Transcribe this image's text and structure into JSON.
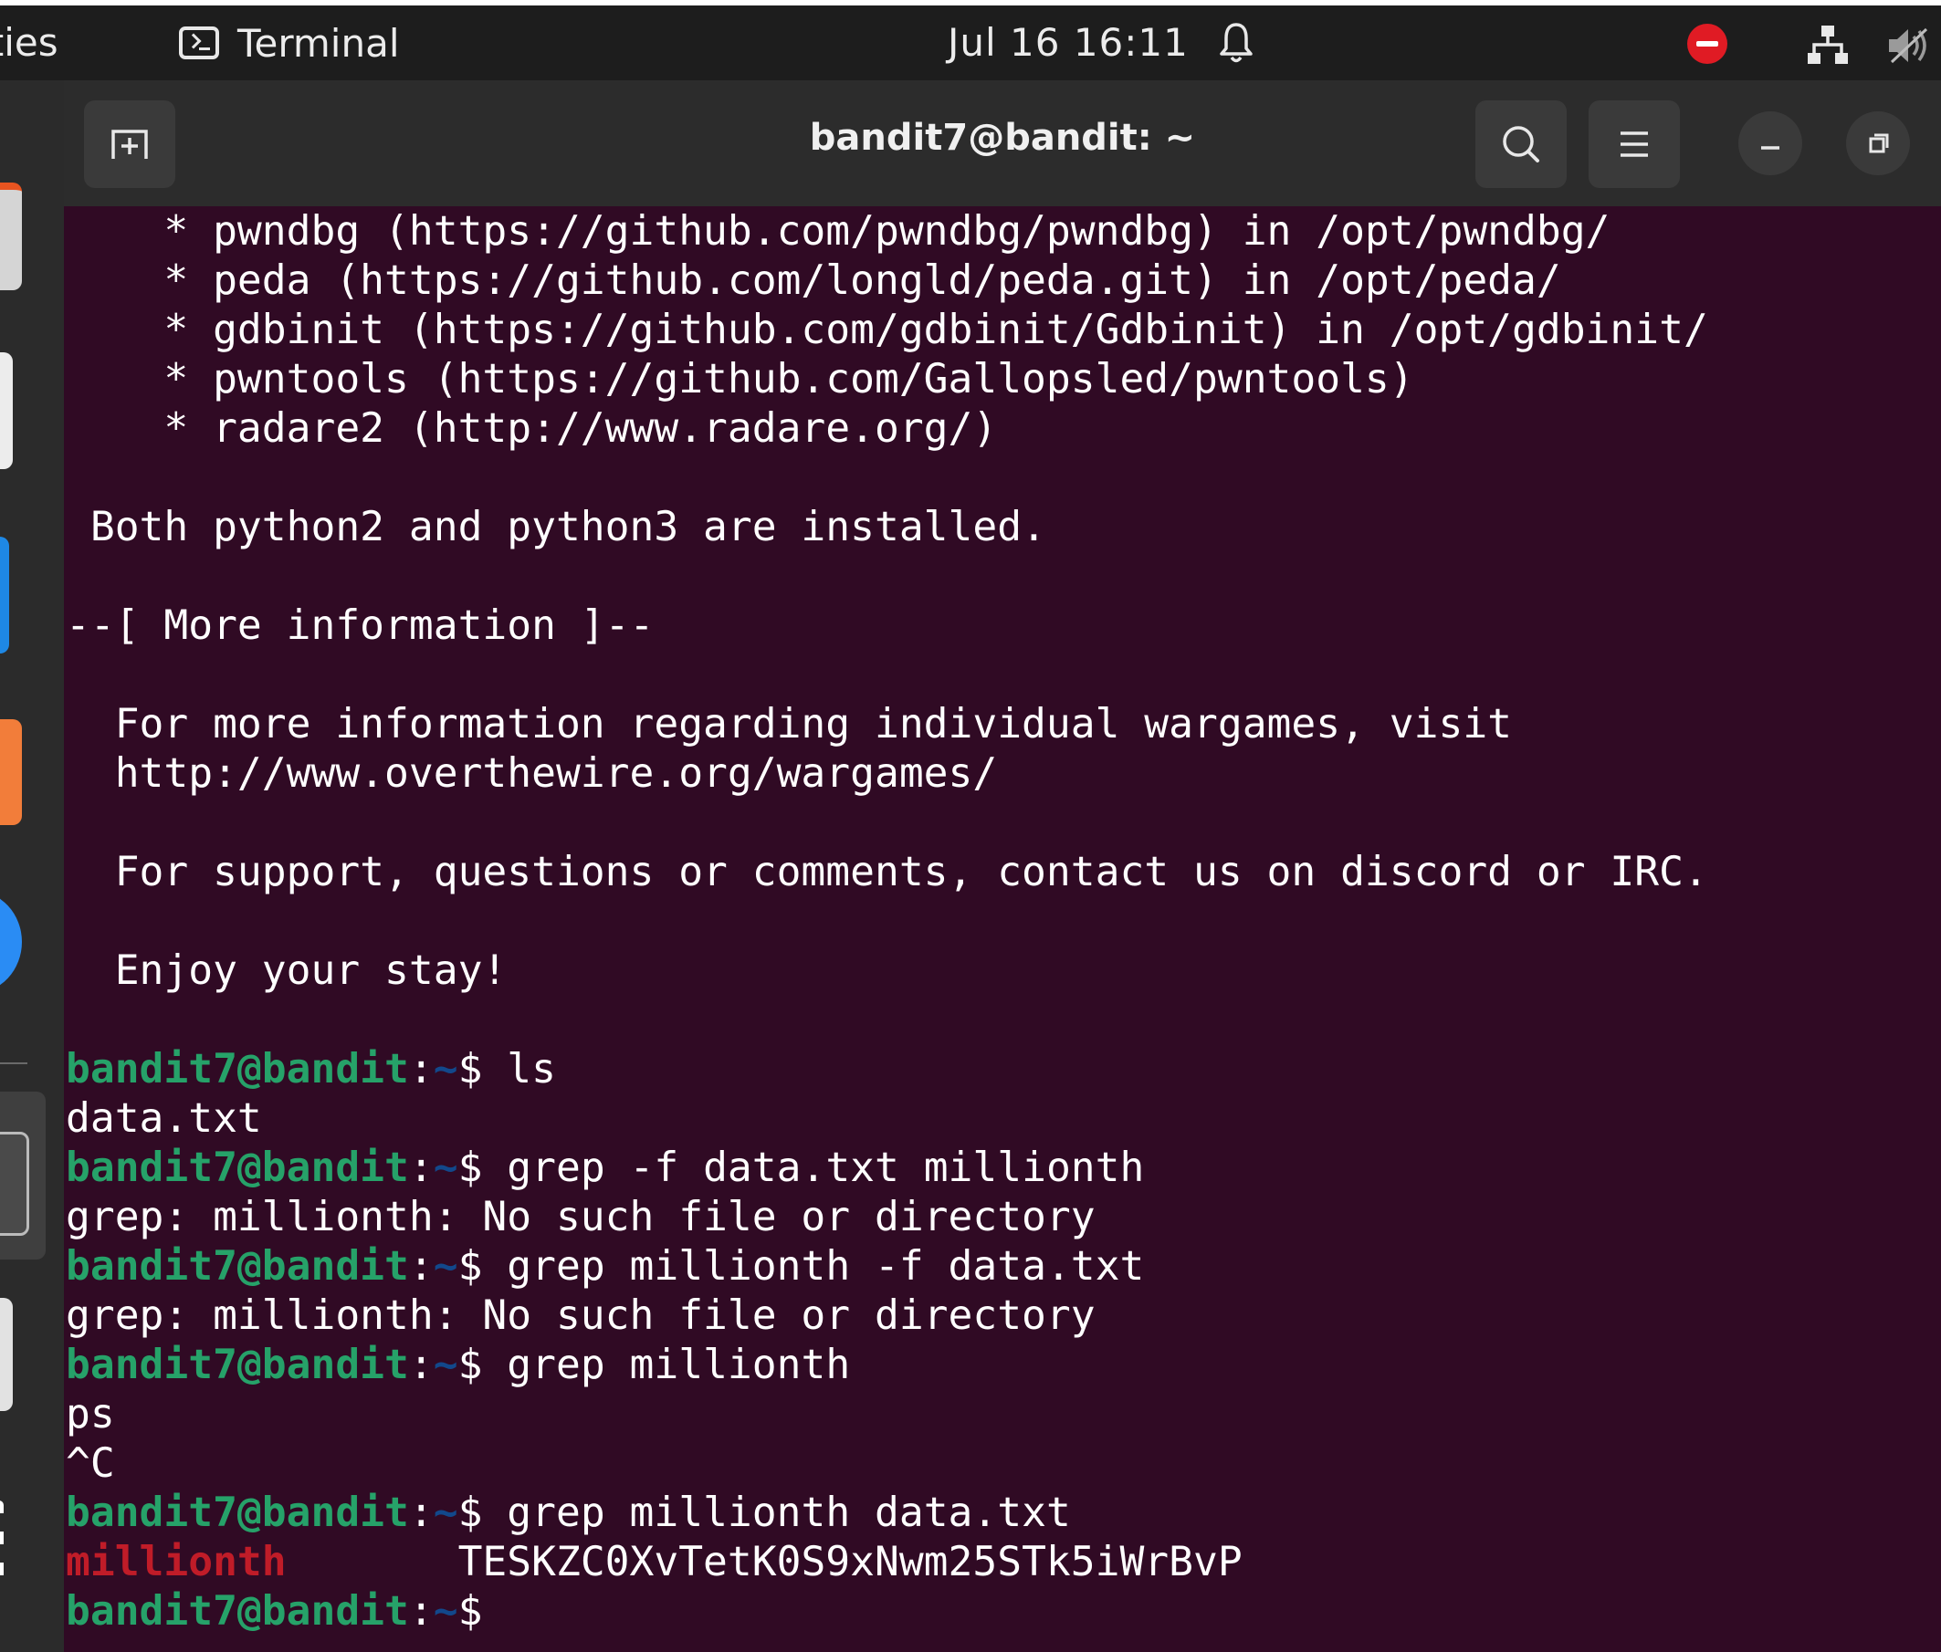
{
  "topbar": {
    "activities_label": "Activities",
    "app_name": "Terminal",
    "clock": "Jul 16  16:11",
    "icons": [
      "terminal-icon",
      "bell-icon",
      "do-not-disturb-icon",
      "network-icon",
      "volume-muted-icon"
    ]
  },
  "window": {
    "title": "bandit7@bandit: ~",
    "buttons": {
      "new_tab": "new-tab-icon",
      "search": "search-icon",
      "menu": "hamburger-menu-icon",
      "minimize": "minimize-icon",
      "maximize": "restore-icon"
    }
  },
  "colors": {
    "terminal_bg": "#300a24",
    "prompt_user": "#26a269",
    "prompt_path": "#12488b",
    "grep_match": "#c01c28",
    "headerbar": "#2c2c2c",
    "topbar": "#1d1d1d"
  },
  "terminal": {
    "prompt_user": "bandit7@bandit",
    "prompt_sep": ":",
    "prompt_path": "~",
    "prompt_sign": "$",
    "motd": [
      "    * pwndbg (https://github.com/pwndbg/pwndbg) in /opt/pwndbg/",
      "    * peda (https://github.com/longld/peda.git) in /opt/peda/",
      "    * gdbinit (https://github.com/gdbinit/Gdbinit) in /opt/gdbinit/",
      "    * pwntools (https://github.com/Gallopsled/pwntools)",
      "    * radare2 (http://www.radare.org/)",
      "",
      " Both python2 and python3 are installed.",
      "",
      "--[ More information ]--",
      "",
      "  For more information regarding individual wargames, visit",
      "  http://www.overthewire.org/wargames/",
      "",
      "  For support, questions or comments, contact us on discord or IRC.",
      "",
      "  Enjoy your stay!",
      ""
    ],
    "session": {
      "cmd1": " ls",
      "out1": "data.txt",
      "cmd2": " grep -f data.txt millionth",
      "out2": "grep: millionth: No such file or directory",
      "cmd3": " grep millionth -f data.txt",
      "out3": "grep: millionth: No such file or directory",
      "cmd4": " grep millionth",
      "out4a": "ps",
      "out4b": "^C",
      "cmd5": " grep millionth data.txt",
      "out5_match": "millionth",
      "out5_rest": "       TESKZC0XvTetK0S9xNwm25STk5iWrBvP",
      "cmd6": ""
    }
  }
}
